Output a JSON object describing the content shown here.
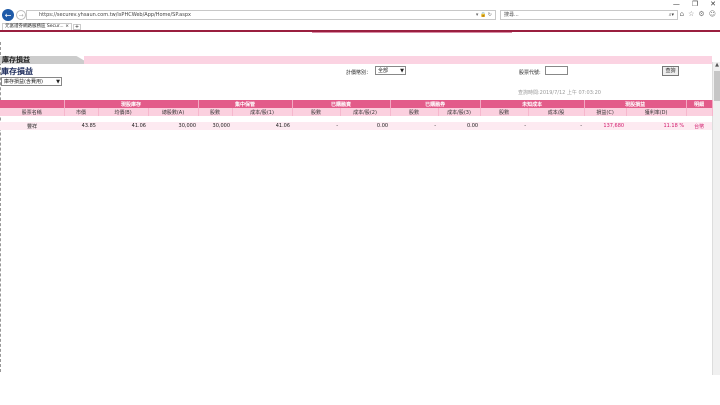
{
  "browser": {
    "url": "https://securev.yhsaun.com.tw/isPHCWeb/App/Home/SP.aspx",
    "search_placeholder": "搜尋...",
    "tab_label": "元富證券網路服務區 Secur...",
    "window_buttons": [
      "—",
      "❐",
      "✕"
    ]
  },
  "page": {
    "section_label": "庫存損益",
    "title": "庫存損益",
    "type_select": "庫存損益(含費用)",
    "account_label": "計價幣別：",
    "account_select": "全部",
    "stock_label": "股票代號:",
    "query_button": "查詢",
    "query_time": "查詢時間:2019/7/12 上午 07:03:20"
  },
  "table": {
    "group_headers": [
      {
        "label": "",
        "span": 1
      },
      {
        "label": "現股庫存",
        "span": 3
      },
      {
        "label": "集中保管",
        "span": 2
      },
      {
        "label": "已購融資",
        "span": 2
      },
      {
        "label": "已購融券",
        "span": 2
      },
      {
        "label": "未知成本",
        "span": 2
      },
      {
        "label": "現股損益",
        "span": 2
      },
      {
        "label": "明細",
        "span": 1
      }
    ],
    "sub_headers": [
      "股票名稱",
      "市價",
      "均價(B)",
      "總股數(A)",
      "股數",
      "成本/股(1)",
      "股數",
      "成本/股(2)",
      "股數",
      "成本/股(3)",
      "股數",
      "成本/股",
      "損益(C)",
      "獲利率(D)",
      ""
    ],
    "rows": [
      [
        "豐祥",
        "43.85",
        "41.06",
        "30,000",
        "30,000",
        "41.06",
        "-",
        "0.00",
        "-",
        "0.00",
        "-",
        "-",
        "137,680",
        "11.18 %",
        "台幣"
      ]
    ]
  }
}
